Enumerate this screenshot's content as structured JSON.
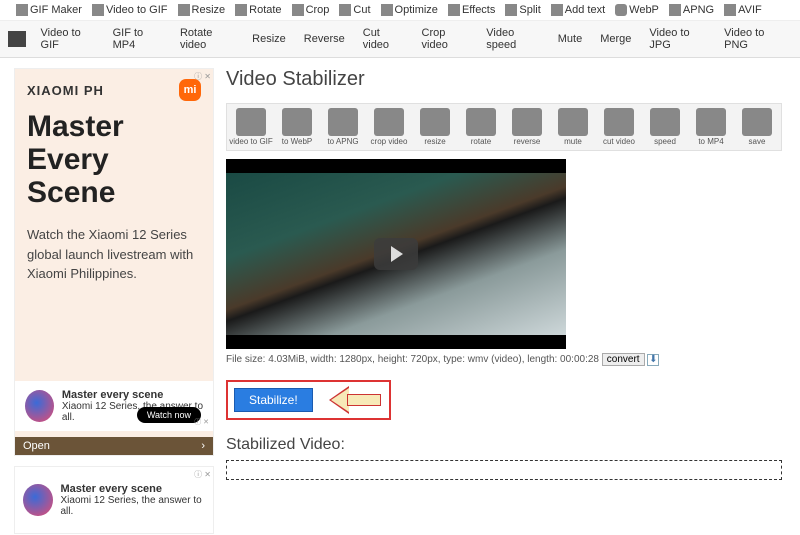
{
  "topnav": {
    "items": [
      {
        "label": "GIF Maker"
      },
      {
        "label": "Video to GIF"
      },
      {
        "label": "Resize"
      },
      {
        "label": "Rotate"
      },
      {
        "label": "Crop"
      },
      {
        "label": "Cut"
      },
      {
        "label": "Optimize"
      },
      {
        "label": "Effects"
      },
      {
        "label": "Split"
      },
      {
        "label": "Add text"
      },
      {
        "label": "WebP"
      },
      {
        "label": "APNG"
      },
      {
        "label": "AVIF"
      }
    ]
  },
  "secnav": {
    "items": [
      {
        "label": "Video to GIF"
      },
      {
        "label": "GIF to MP4"
      },
      {
        "label": "Rotate video"
      },
      {
        "label": "Resize"
      },
      {
        "label": "Reverse"
      },
      {
        "label": "Cut video"
      },
      {
        "label": "Crop video"
      },
      {
        "label": "Video speed"
      },
      {
        "label": "Mute"
      },
      {
        "label": "Merge"
      },
      {
        "label": "Video to JPG"
      },
      {
        "label": "Video to PNG"
      }
    ]
  },
  "ad1": {
    "brand": "XIAOMI PH",
    "headline": "Master Every Scene",
    "copy": "Watch the Xiaomi 12 Series global launch livestream with Xiaomi Philippines.",
    "sub_head": "Master every scene",
    "sub_line": "Xiaomi 12 Series, the answer to all.",
    "watch": "Watch now",
    "open": "Open",
    "badge": "ⓘ ✕"
  },
  "ad2": {
    "head": "Master every scene",
    "sub": "Xiaomi 12 Series, the answer to all."
  },
  "page": {
    "title": "Video Stabilizer",
    "stabilized_heading": "Stabilized Video:"
  },
  "toolbar": {
    "tools": [
      {
        "label": "video to GIF"
      },
      {
        "label": "to WebP"
      },
      {
        "label": "to APNG"
      },
      {
        "label": "crop video"
      },
      {
        "label": "resize"
      },
      {
        "label": "rotate"
      },
      {
        "label": "reverse"
      },
      {
        "label": "mute"
      },
      {
        "label": "cut video"
      },
      {
        "label": "speed"
      },
      {
        "label": "to MP4"
      },
      {
        "label": "save"
      }
    ]
  },
  "fileinfo": {
    "text": "File size: 4.03MiB, width: 1280px, height: 720px, type: wmv (video), length: 00:00:28",
    "convert": "convert"
  },
  "actions": {
    "stabilize": "Stabilize!"
  }
}
